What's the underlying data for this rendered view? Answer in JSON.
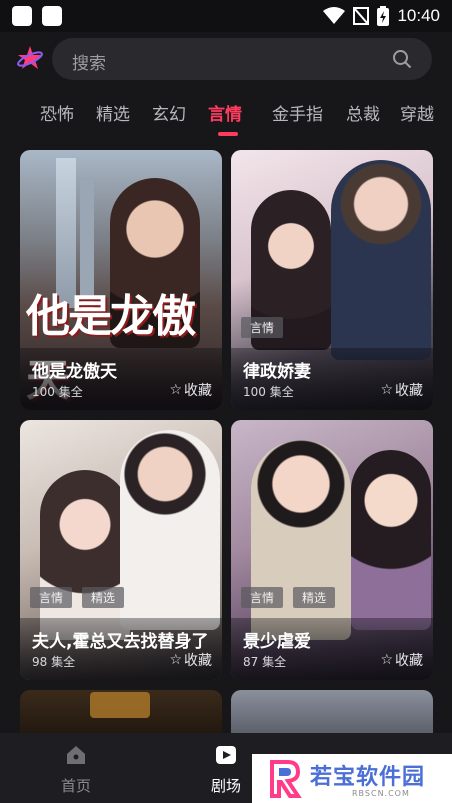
{
  "status_bar": {
    "time": "10:40"
  },
  "search": {
    "placeholder": "搜索"
  },
  "tabs": [
    {
      "label": "恐怖"
    },
    {
      "label": "精选"
    },
    {
      "label": "玄幻"
    },
    {
      "label": "言情"
    },
    {
      "label": "金手指"
    },
    {
      "label": "总裁"
    },
    {
      "label": "穿越"
    }
  ],
  "active_tab": "言情",
  "cards": [
    {
      "title": "他是龙傲天",
      "episodes": "100 集全",
      "fav": "收藏",
      "tags": [],
      "poster_text": "他是龙傲天"
    },
    {
      "title": "律政娇妻",
      "episodes": "100 集全",
      "fav": "收藏",
      "tags": [
        "言情"
      ]
    },
    {
      "title": "夫人,霍总又去找替身了",
      "episodes": "98 集全",
      "fav": "收藏",
      "tags": [
        "言情",
        "精选"
      ]
    },
    {
      "title": "景少虐爱",
      "episodes": "87 集全",
      "fav": "收藏",
      "tags": [
        "言情",
        "精选"
      ]
    }
  ],
  "bottom_nav": [
    {
      "label": "首页"
    },
    {
      "label": "剧场"
    }
  ],
  "watermark": {
    "text": "若宝软件园",
    "sub": "RBSCN.COM"
  },
  "colors": {
    "accent": "#ff3b5f",
    "background": "#17171a"
  }
}
